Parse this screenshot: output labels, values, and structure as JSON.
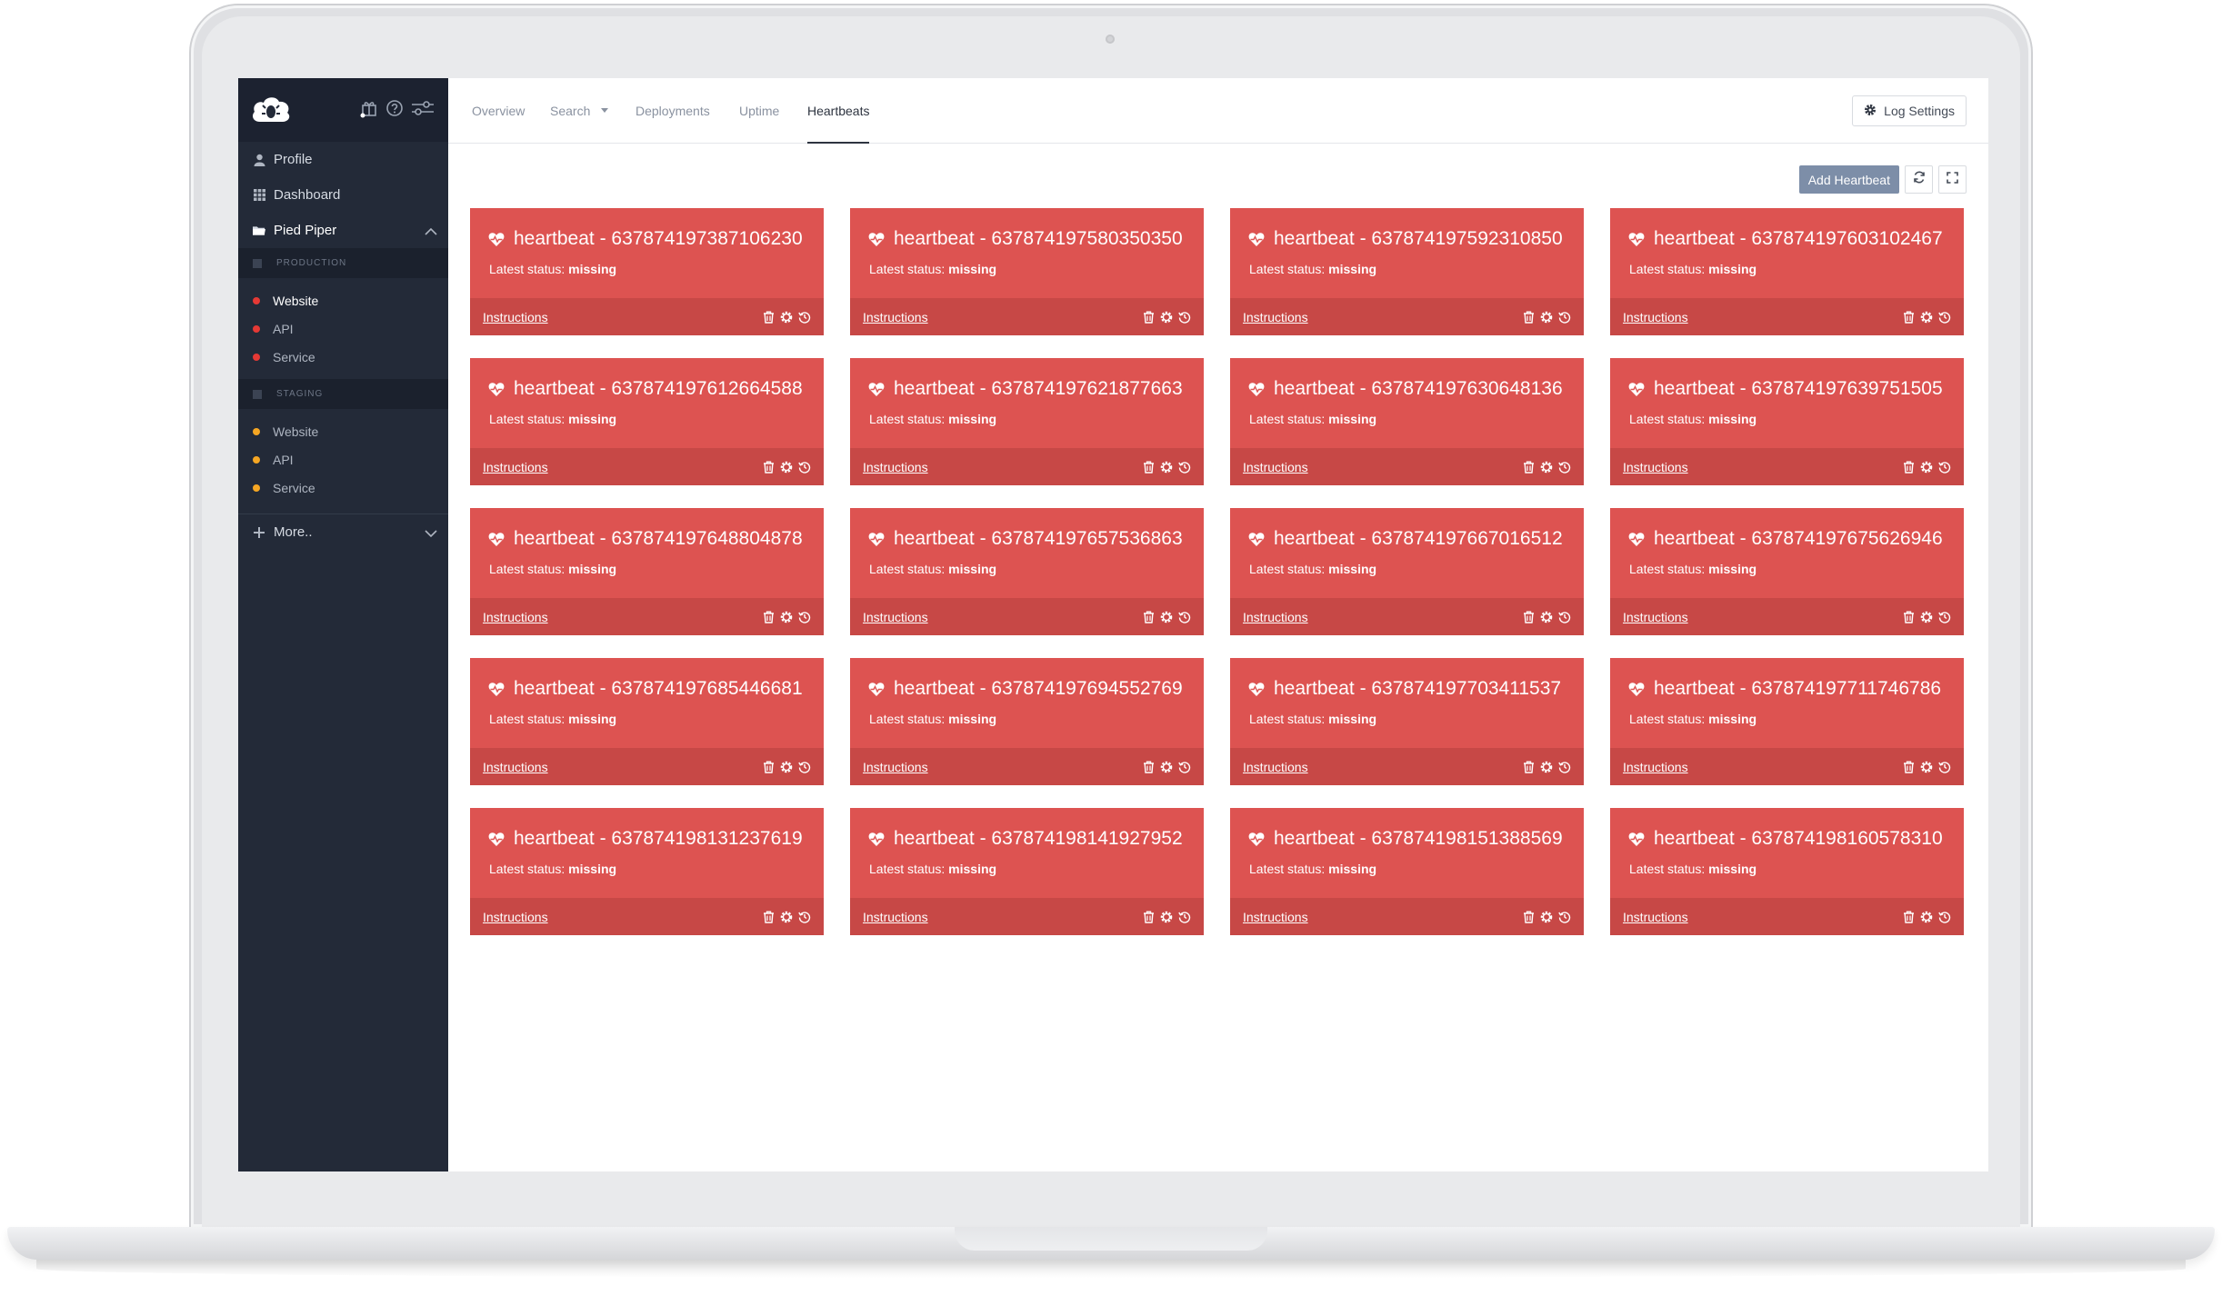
{
  "colors": {
    "sidebar_bg": "#232a38",
    "card_red": "#dd5351",
    "card_footer_red": "#c74846",
    "prod_dot": "#e53935",
    "staging_dot": "#f5a623",
    "add_button": "#7d8ea8"
  },
  "sidebar": {
    "logo_icon": "cloud-bug-logo",
    "top_icons": [
      "gift-icon",
      "help-icon",
      "settings-sliders-icon"
    ],
    "items": [
      {
        "icon": "user-icon",
        "label": "Profile"
      },
      {
        "icon": "grid-icon",
        "label": "Dashboard"
      }
    ],
    "project": {
      "icon": "folder-icon",
      "label": "Pied Piper"
    },
    "environments": [
      {
        "label": "PRODUCTION",
        "services": [
          "Website",
          "API",
          "Service"
        ]
      },
      {
        "label": "STAGING",
        "services": [
          "Website",
          "API",
          "Service"
        ]
      }
    ],
    "more_label": "More.."
  },
  "tabs": [
    "Overview",
    "Search",
    "Deployments",
    "Uptime",
    "Heartbeats"
  ],
  "active_tab": "Heartbeats",
  "header": {
    "log_settings_label": "Log Settings"
  },
  "toolbar": {
    "add_label": "Add Heartbeat"
  },
  "card_labels": {
    "status_prefix": "Latest status: ",
    "instructions": "Instructions"
  },
  "heartbeats": [
    {
      "name": "heartbeat - 637874197387106230",
      "status": "missing"
    },
    {
      "name": "heartbeat - 637874197580350350",
      "status": "missing"
    },
    {
      "name": "heartbeat - 637874197592310850",
      "status": "missing"
    },
    {
      "name": "heartbeat - 637874197603102467",
      "status": "missing"
    },
    {
      "name": "heartbeat - 637874197612664588",
      "status": "missing"
    },
    {
      "name": "heartbeat - 637874197621877663",
      "status": "missing"
    },
    {
      "name": "heartbeat - 637874197630648136",
      "status": "missing"
    },
    {
      "name": "heartbeat - 637874197639751505",
      "status": "missing"
    },
    {
      "name": "heartbeat - 637874197648804878",
      "status": "missing"
    },
    {
      "name": "heartbeat - 637874197657536863",
      "status": "missing"
    },
    {
      "name": "heartbeat - 637874197667016512",
      "status": "missing"
    },
    {
      "name": "heartbeat - 637874197675626946",
      "status": "missing"
    },
    {
      "name": "heartbeat - 637874197685446681",
      "status": "missing"
    },
    {
      "name": "heartbeat - 637874197694552769",
      "status": "missing"
    },
    {
      "name": "heartbeat - 637874197703411537",
      "status": "missing"
    },
    {
      "name": "heartbeat - 637874197711746786",
      "status": "missing"
    },
    {
      "name": "heartbeat - 637874198131237619",
      "status": "missing"
    },
    {
      "name": "heartbeat - 637874198141927952",
      "status": "missing"
    },
    {
      "name": "heartbeat - 637874198151388569",
      "status": "missing"
    },
    {
      "name": "heartbeat - 637874198160578310",
      "status": "missing"
    }
  ]
}
